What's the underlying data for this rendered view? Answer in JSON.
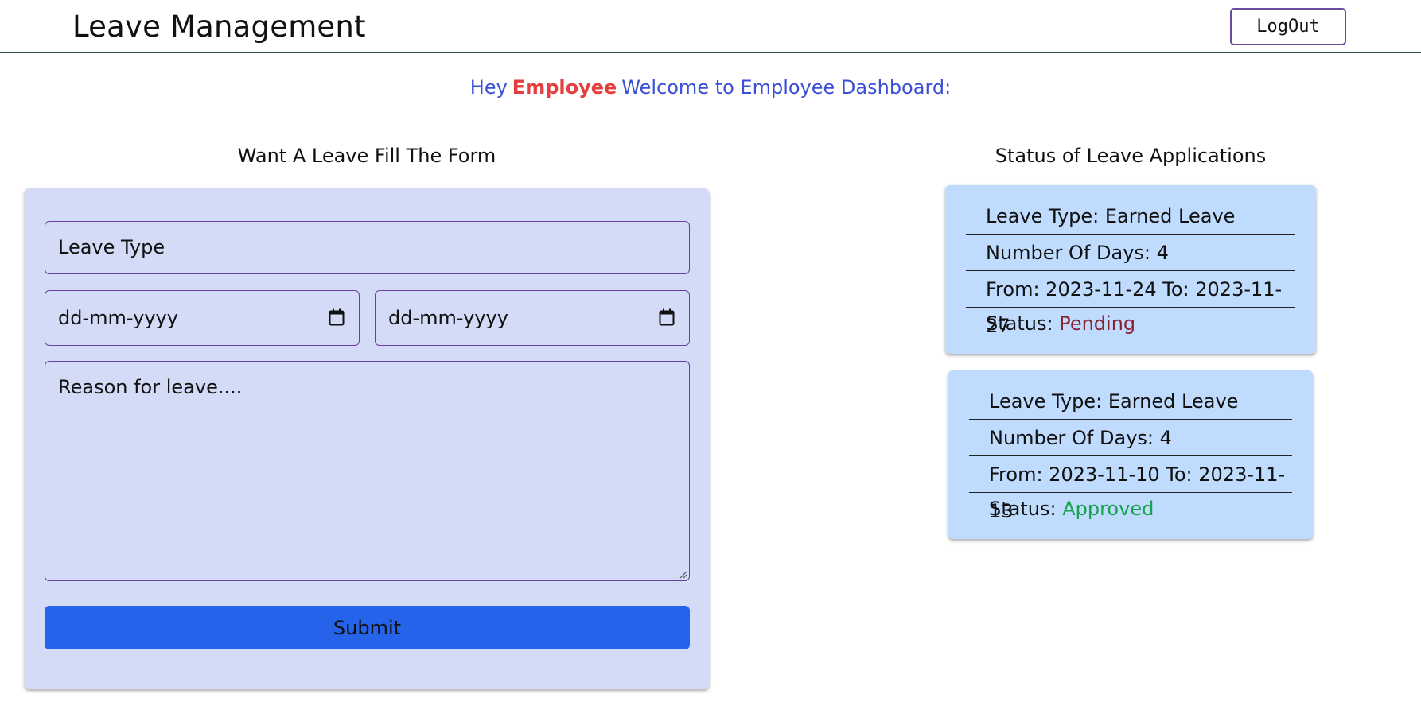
{
  "header": {
    "title": "Leave Management",
    "logout_label": "LogOut"
  },
  "welcome": {
    "prefix": "Hey",
    "name": "Employee",
    "suffix": "Welcome to Employee Dashboard:"
  },
  "form": {
    "heading": "Want A Leave Fill The Form",
    "leave_type_placeholder": "Leave Type",
    "from_date_placeholder": "dd-mm-yyyy",
    "to_date_placeholder": "dd-mm-yyyy",
    "reason_placeholder": "Reason for leave....",
    "submit_label": "Submit"
  },
  "status_section": {
    "heading": "Status of Leave Applications",
    "applications": [
      {
        "leave_type": "Leave Type: Earned Leave",
        "days": "Number Of Days: 4",
        "range": "From: 2023-11-24 To: 2023-11-27",
        "status_label": "Status:",
        "status_value": "Pending"
      },
      {
        "leave_type": "Leave Type: Earned Leave",
        "days": "Number Of Days: 4",
        "range": "From: 2023-11-10 To: 2023-11-13",
        "status_label": "Status:",
        "status_value": "Approved"
      }
    ]
  },
  "colors": {
    "welcome_text": "#3b4fd6",
    "welcome_name": "#e53e3e",
    "form_card_bg": "#d3dbf6",
    "submit_bg": "#2563eb",
    "status_card_bg": "#bfdbfe",
    "status_pending": "#8b2232",
    "status_approved": "#16a34a"
  },
  "icons": [
    "calendar-icon",
    "resize-handle-icon"
  ]
}
